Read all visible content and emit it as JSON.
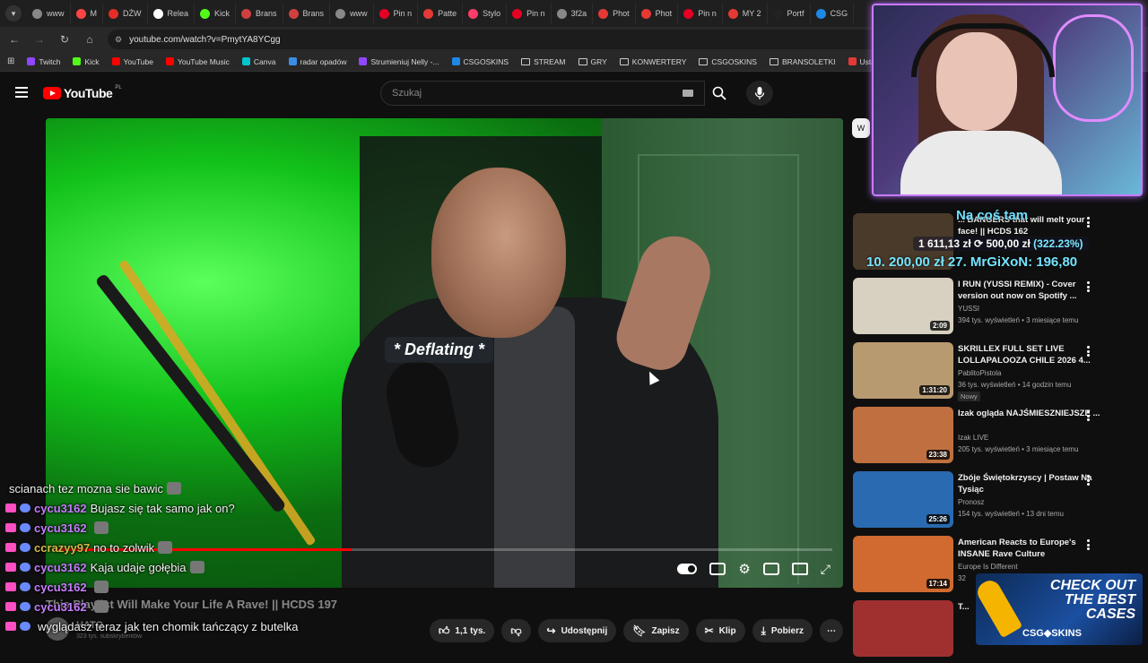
{
  "browser": {
    "tabs": [
      {
        "label": "www",
        "color": "#888888"
      },
      {
        "label": "M",
        "color": "#ff4444"
      },
      {
        "label": "DŹW",
        "color": "#e52d27"
      },
      {
        "label": "Relea",
        "color": "#ffffff"
      },
      {
        "label": "Kick",
        "color": "#53fc18"
      },
      {
        "label": "Brans",
        "color": "#d04040"
      },
      {
        "label": "Brans",
        "color": "#d04040"
      },
      {
        "label": "www",
        "color": "#888888"
      },
      {
        "label": "Pin n",
        "color": "#e60023"
      },
      {
        "label": "Patte",
        "color": "#e53935"
      },
      {
        "label": "Stylo",
        "color": "#ff3d6a"
      },
      {
        "label": "Pin n",
        "color": "#e60023"
      },
      {
        "label": "3f2a",
        "color": "#888888"
      },
      {
        "label": "Phot",
        "color": "#e53935"
      },
      {
        "label": "Phot",
        "color": "#e53935"
      },
      {
        "label": "Pin n",
        "color": "#e60023"
      },
      {
        "label": "MY 2",
        "color": "#e53935"
      },
      {
        "label": "Portf",
        "color": "#222222"
      },
      {
        "label": "CSG",
        "color": "#1e88e5"
      }
    ],
    "url": "youtube.com/watch?v=PmytYA8YCgg",
    "bookmarks": [
      {
        "label": "Twitch",
        "type": "site",
        "color": "#9146ff"
      },
      {
        "label": "Kick",
        "type": "site",
        "color": "#53fc18"
      },
      {
        "label": "YouTube",
        "type": "site",
        "color": "#ff0000"
      },
      {
        "label": "YouTube Music",
        "type": "site",
        "color": "#ff0000"
      },
      {
        "label": "Canva",
        "type": "site",
        "color": "#00c4cc"
      },
      {
        "label": "radar opadów",
        "type": "site",
        "color": "#3a8ee6"
      },
      {
        "label": "Strumieniuj Nelly -...",
        "type": "site",
        "color": "#9146ff"
      },
      {
        "label": "CSGOSKINS",
        "type": "site",
        "color": "#1e88e5"
      },
      {
        "label": "STREAM",
        "type": "folder"
      },
      {
        "label": "GRY",
        "type": "folder"
      },
      {
        "label": "KONWERTERY",
        "type": "folder"
      },
      {
        "label": "CSGOSKINS",
        "type": "folder"
      },
      {
        "label": "BRANSOLETKI",
        "type": "folder"
      },
      {
        "label": "Ustawienia strumien...",
        "type": "site",
        "color": "#e53935"
      }
    ]
  },
  "youtube": {
    "logo_text": "YouTube",
    "region": "PL",
    "search_placeholder": "Szukaj",
    "player": {
      "caption": "* Deflating *",
      "progress_percent": 38
    },
    "video_title": "This Playlist Will Make Your Life A Rave! || HCDS 197",
    "channel": "HATO",
    "subscribers": "323 tys. subskrybentów",
    "actions": {
      "likes": "1,1 tys.",
      "share": "Udostępnij",
      "save": "Zapisz",
      "clip": "Klip",
      "download": "Pobierz"
    },
    "chip_label": "W",
    "recommendations": [
      {
        "title": "... BANGERS that will melt your face! || HCDS 162",
        "channel": "",
        "meta": "",
        "duration": "",
        "thumb": "#4a3a2a"
      },
      {
        "title": "I RUN (YUSSI REMIX) - Cover version out now on Spotify ...",
        "channel": "YUSSI",
        "meta": "394 tys. wyświetleń • 3 miesiące temu",
        "duration": "2:09",
        "thumb": "#d8d0c0"
      },
      {
        "title": "SKRILLEX FULL SET LIVE LOLLAPALOOZA CHILE 2026 4...",
        "channel": "PablitoPistola",
        "meta": "36 tys. wyświetleń • 14 godzin temu",
        "duration": "1:31:20",
        "badge": "Nowy",
        "thumb": "#b89a70"
      },
      {
        "title": "Izak ogląda NAJŚMIESZNIEJSZE ...",
        "channel": "Izak LIVE",
        "meta": "205 tys. wyświetleń • 3 miesiące temu",
        "duration": "23:38",
        "thumb": "#c07040"
      },
      {
        "title": "Zbóje Świętokrzyscy | Postaw Na Tysiąc",
        "channel": "Pronosz",
        "meta": "154 tys. wyświetleń • 13 dni temu",
        "duration": "25:26",
        "thumb": "#2a6ab0"
      },
      {
        "title": "American Reacts to Europe's INSANE Rave Culture",
        "channel": "Europe Is Different",
        "meta": "32",
        "duration": "17:14",
        "thumb": "#d06a30"
      },
      {
        "title": "T...",
        "channel": "",
        "meta": "",
        "duration": "",
        "thumb": "#a03030"
      }
    ]
  },
  "stream_overlay": {
    "title": "Na coś tam",
    "amount": "1 611,13 zł",
    "target": "500,00 zł",
    "percent": "(322.23%)",
    "ticker": "10. 200,00 zł    27. MrGiXoN: 196,80",
    "chat": [
      {
        "user": "",
        "color": "#ffffff",
        "message": "scianach tez mozna sie bawic",
        "badges": false,
        "emote": true
      },
      {
        "user": "cycu3162",
        "color": "#c67dff",
        "message": "Bujasz się tak samo jak on?",
        "badges": true,
        "emote": false
      },
      {
        "user": "cycu3162",
        "color": "#c67dff",
        "message": "",
        "badges": true,
        "emote": true
      },
      {
        "user": "ccrazyy97",
        "color": "#d4b84a",
        "message": "no to zolwik",
        "badges": true,
        "emote": true
      },
      {
        "user": "cycu3162",
        "color": "#c67dff",
        "message": "Kaja udaje gołębia",
        "badges": true,
        "emote": true
      },
      {
        "user": "cycu3162",
        "color": "#c67dff",
        "message": "",
        "badges": true,
        "emote": true
      },
      {
        "user": "cycu3162",
        "color": "#c67dff",
        "message": "",
        "badges": true,
        "emote": true
      },
      {
        "user": "",
        "color": "#ffffff",
        "message": "wyglądasz teraz jak ten chomik tańczący z butelka",
        "badges": true,
        "emote": false
      }
    ],
    "promo": {
      "line1": "CHECK OUT",
      "line2": "THE BEST",
      "line3": "CASES",
      "logo": "CSG◆SKINS"
    }
  }
}
